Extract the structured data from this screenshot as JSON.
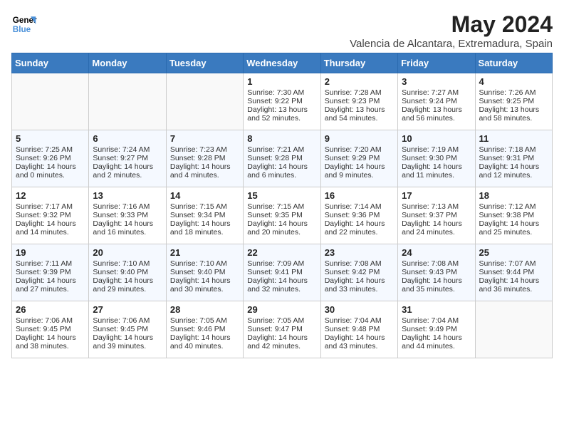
{
  "logo": {
    "line1": "General",
    "line2": "Blue"
  },
  "title": "May 2024",
  "subtitle": "Valencia de Alcantara, Extremadura, Spain",
  "headers": [
    "Sunday",
    "Monday",
    "Tuesday",
    "Wednesday",
    "Thursday",
    "Friday",
    "Saturday"
  ],
  "weeks": [
    [
      {
        "day": "",
        "info": ""
      },
      {
        "day": "",
        "info": ""
      },
      {
        "day": "",
        "info": ""
      },
      {
        "day": "1",
        "info": "Sunrise: 7:30 AM\nSunset: 9:22 PM\nDaylight: 13 hours\nand 52 minutes."
      },
      {
        "day": "2",
        "info": "Sunrise: 7:28 AM\nSunset: 9:23 PM\nDaylight: 13 hours\nand 54 minutes."
      },
      {
        "day": "3",
        "info": "Sunrise: 7:27 AM\nSunset: 9:24 PM\nDaylight: 13 hours\nand 56 minutes."
      },
      {
        "day": "4",
        "info": "Sunrise: 7:26 AM\nSunset: 9:25 PM\nDaylight: 13 hours\nand 58 minutes."
      }
    ],
    [
      {
        "day": "5",
        "info": "Sunrise: 7:25 AM\nSunset: 9:26 PM\nDaylight: 14 hours\nand 0 minutes."
      },
      {
        "day": "6",
        "info": "Sunrise: 7:24 AM\nSunset: 9:27 PM\nDaylight: 14 hours\nand 2 minutes."
      },
      {
        "day": "7",
        "info": "Sunrise: 7:23 AM\nSunset: 9:28 PM\nDaylight: 14 hours\nand 4 minutes."
      },
      {
        "day": "8",
        "info": "Sunrise: 7:21 AM\nSunset: 9:28 PM\nDaylight: 14 hours\nand 6 minutes."
      },
      {
        "day": "9",
        "info": "Sunrise: 7:20 AM\nSunset: 9:29 PM\nDaylight: 14 hours\nand 9 minutes."
      },
      {
        "day": "10",
        "info": "Sunrise: 7:19 AM\nSunset: 9:30 PM\nDaylight: 14 hours\nand 11 minutes."
      },
      {
        "day": "11",
        "info": "Sunrise: 7:18 AM\nSunset: 9:31 PM\nDaylight: 14 hours\nand 12 minutes."
      }
    ],
    [
      {
        "day": "12",
        "info": "Sunrise: 7:17 AM\nSunset: 9:32 PM\nDaylight: 14 hours\nand 14 minutes."
      },
      {
        "day": "13",
        "info": "Sunrise: 7:16 AM\nSunset: 9:33 PM\nDaylight: 14 hours\nand 16 minutes."
      },
      {
        "day": "14",
        "info": "Sunrise: 7:15 AM\nSunset: 9:34 PM\nDaylight: 14 hours\nand 18 minutes."
      },
      {
        "day": "15",
        "info": "Sunrise: 7:15 AM\nSunset: 9:35 PM\nDaylight: 14 hours\nand 20 minutes."
      },
      {
        "day": "16",
        "info": "Sunrise: 7:14 AM\nSunset: 9:36 PM\nDaylight: 14 hours\nand 22 minutes."
      },
      {
        "day": "17",
        "info": "Sunrise: 7:13 AM\nSunset: 9:37 PM\nDaylight: 14 hours\nand 24 minutes."
      },
      {
        "day": "18",
        "info": "Sunrise: 7:12 AM\nSunset: 9:38 PM\nDaylight: 14 hours\nand 25 minutes."
      }
    ],
    [
      {
        "day": "19",
        "info": "Sunrise: 7:11 AM\nSunset: 9:39 PM\nDaylight: 14 hours\nand 27 minutes."
      },
      {
        "day": "20",
        "info": "Sunrise: 7:10 AM\nSunset: 9:40 PM\nDaylight: 14 hours\nand 29 minutes."
      },
      {
        "day": "21",
        "info": "Sunrise: 7:10 AM\nSunset: 9:40 PM\nDaylight: 14 hours\nand 30 minutes."
      },
      {
        "day": "22",
        "info": "Sunrise: 7:09 AM\nSunset: 9:41 PM\nDaylight: 14 hours\nand 32 minutes."
      },
      {
        "day": "23",
        "info": "Sunrise: 7:08 AM\nSunset: 9:42 PM\nDaylight: 14 hours\nand 33 minutes."
      },
      {
        "day": "24",
        "info": "Sunrise: 7:08 AM\nSunset: 9:43 PM\nDaylight: 14 hours\nand 35 minutes."
      },
      {
        "day": "25",
        "info": "Sunrise: 7:07 AM\nSunset: 9:44 PM\nDaylight: 14 hours\nand 36 minutes."
      }
    ],
    [
      {
        "day": "26",
        "info": "Sunrise: 7:06 AM\nSunset: 9:45 PM\nDaylight: 14 hours\nand 38 minutes."
      },
      {
        "day": "27",
        "info": "Sunrise: 7:06 AM\nSunset: 9:45 PM\nDaylight: 14 hours\nand 39 minutes."
      },
      {
        "day": "28",
        "info": "Sunrise: 7:05 AM\nSunset: 9:46 PM\nDaylight: 14 hours\nand 40 minutes."
      },
      {
        "day": "29",
        "info": "Sunrise: 7:05 AM\nSunset: 9:47 PM\nDaylight: 14 hours\nand 42 minutes."
      },
      {
        "day": "30",
        "info": "Sunrise: 7:04 AM\nSunset: 9:48 PM\nDaylight: 14 hours\nand 43 minutes."
      },
      {
        "day": "31",
        "info": "Sunrise: 7:04 AM\nSunset: 9:49 PM\nDaylight: 14 hours\nand 44 minutes."
      },
      {
        "day": "",
        "info": ""
      }
    ]
  ]
}
